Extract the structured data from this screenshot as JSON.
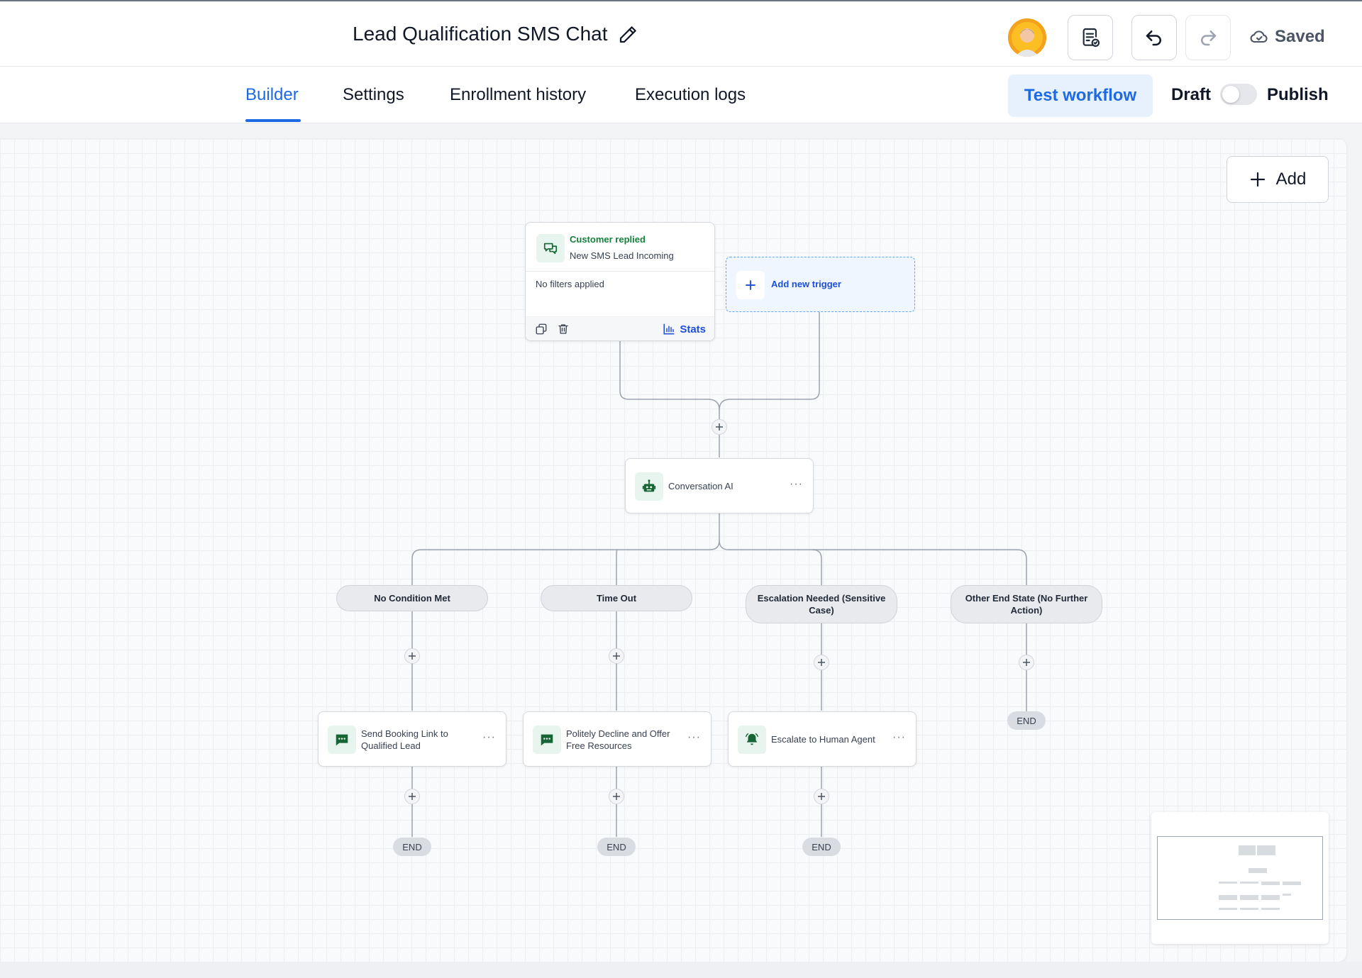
{
  "header": {
    "title": "Lead Qualification SMS Chat",
    "saved_label": "Saved"
  },
  "tabs": [
    {
      "label": "Builder",
      "active": true
    },
    {
      "label": "Settings"
    },
    {
      "label": "Enrollment history"
    },
    {
      "label": "Execution logs"
    }
  ],
  "actions": {
    "test_workflow": "Test workflow",
    "draft": "Draft",
    "publish": "Publish",
    "publish_enabled": false
  },
  "canvas": {
    "add_label": "Add",
    "trigger": {
      "type": "Customer replied",
      "name": "New SMS Lead Incoming",
      "filters": "No filters applied",
      "stats_label": "Stats"
    },
    "add_trigger_label": "Add new trigger",
    "ai_node": {
      "label": "Conversation AI",
      "more": "···"
    },
    "branches": [
      {
        "label": "No Condition Met"
      },
      {
        "label": "Time Out"
      },
      {
        "label": "Escalation Needed (Sensitive Case)"
      },
      {
        "label": "Other End State (No Further Action)"
      }
    ],
    "branch_actions": [
      {
        "label": "Send Booking Link to Qualified Lead",
        "icon": "sms-icon",
        "more": "···"
      },
      {
        "label": "Politely Decline and Offer Free Resources",
        "icon": "sms-icon",
        "more": "···"
      },
      {
        "label": "Escalate to Human Agent",
        "icon": "bell-icon",
        "more": "···"
      }
    ],
    "end_label": "END"
  },
  "colors": {
    "accent": "#1d6ae5",
    "trigger_type": "#15803d",
    "icon_green": "#166534",
    "icon_bg": "#e8f5ee"
  }
}
